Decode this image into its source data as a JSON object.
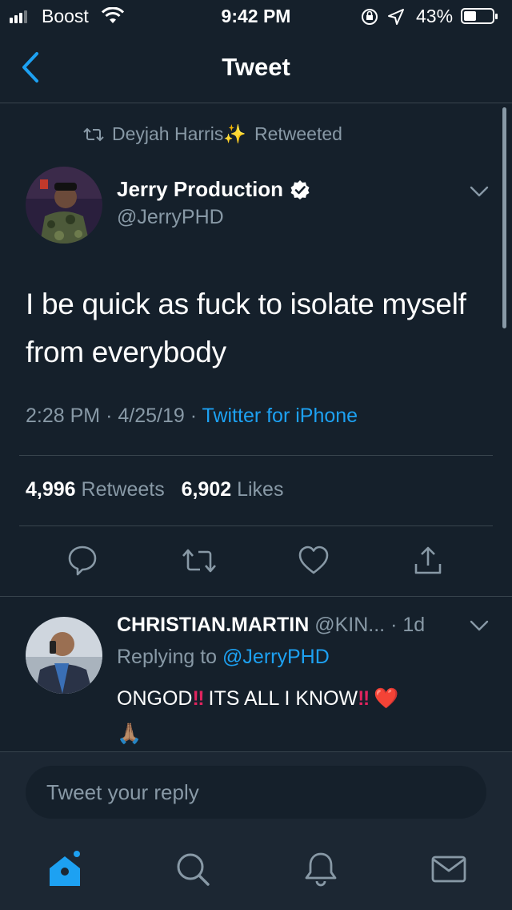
{
  "status_bar": {
    "carrier": "Boost",
    "time": "9:42 PM",
    "battery_percent": "43%",
    "battery_level": 0.43
  },
  "nav": {
    "title": "Tweet"
  },
  "tweet": {
    "retweeted_by": "Deyjah Harris",
    "retweeted_emoji": "✨",
    "retweeted_label": "Retweeted",
    "author_name": "Jerry Production",
    "author_handle": "@JerryPHD",
    "text": "I be quick as fuck to isolate myself from everybody",
    "time": "2:28 PM",
    "date": "4/25/19",
    "separator": "·",
    "source": "Twitter for iPhone",
    "retweets_count": "4,996",
    "retweets_label": "Retweets",
    "likes_count": "6,902",
    "likes_label": "Likes"
  },
  "reply": {
    "author_name": "CHRISTIAN.MARTIN",
    "author_handle": "@KIN...",
    "age": "· 1d",
    "replying_label": "Replying to",
    "replying_to": "@JerryPHD",
    "text_part1": "ONGOD",
    "text_bang": "‼",
    "text_part2": "ITS ALL I KNOW",
    "emoji_heart": "❤️",
    "emoji_hands": "🙏🏽"
  },
  "composer": {
    "placeholder": "Tweet your reply"
  },
  "icons": {
    "back": "back-chevron-icon",
    "retweet": "retweet-icon",
    "verified": "verified-badge-icon",
    "reply": "reply-icon",
    "like": "heart-icon",
    "share": "share-icon",
    "home": "home-icon",
    "search": "search-icon",
    "notifications": "bell-icon",
    "messages": "mail-icon"
  },
  "colors": {
    "background": "#15202b",
    "accent": "#1da1f2",
    "muted": "#8899a6",
    "divider": "#38444d"
  }
}
